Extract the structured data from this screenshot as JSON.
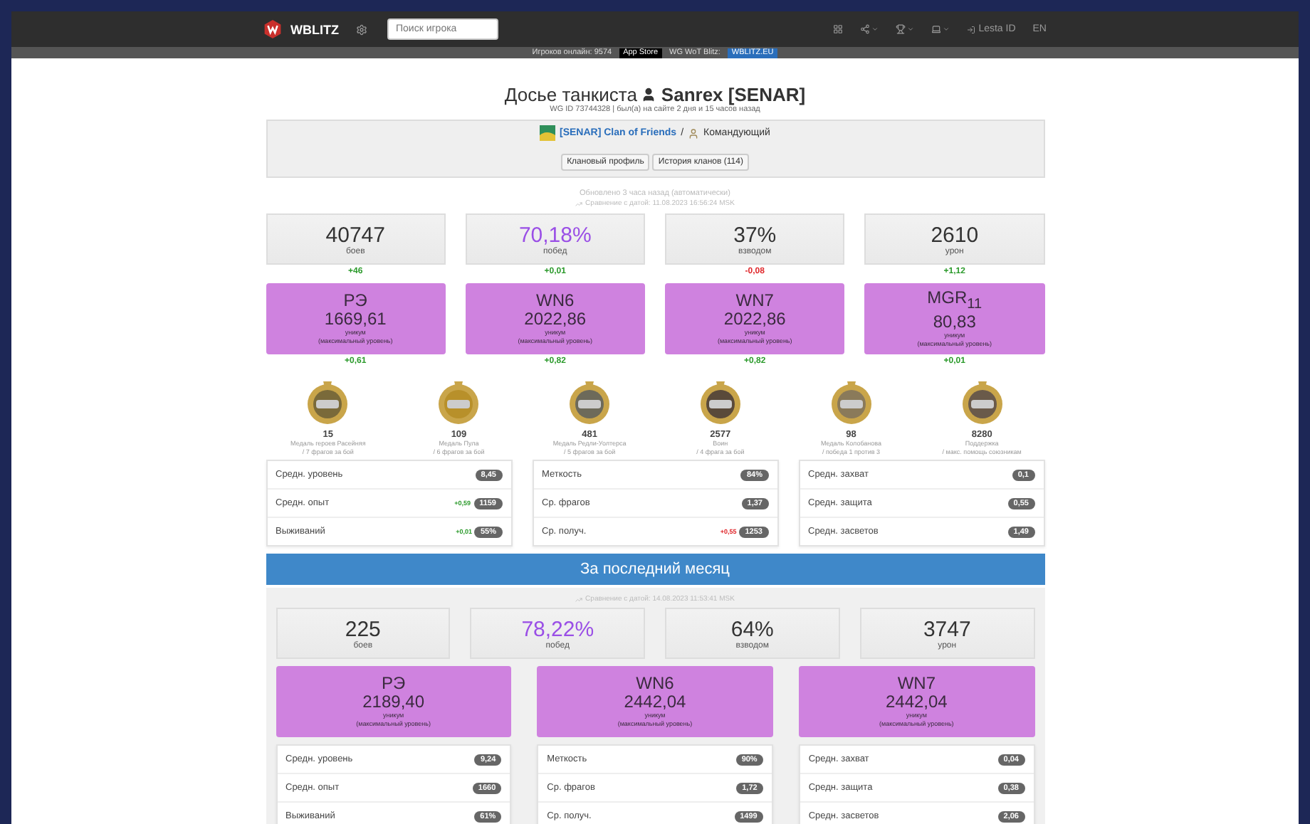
{
  "navbar": {
    "brand": "WBLITZ",
    "search": {
      "placeholder": "Поиск игрока"
    },
    "login": "Lesta ID",
    "language": "EN"
  },
  "subbar": {
    "online": "Игроков онлайн: 9574",
    "store": "App Store",
    "server_label": "WG WoT Blitz:",
    "server_link": "WBLITZ.EU"
  },
  "header": {
    "title": "Досье танкиста",
    "player": "Sanrex [SENAR]",
    "subtitle": "WG ID 73744328 | был(а) на сайте 2 дня и 15 часов назад"
  },
  "clan": {
    "name": "[SENAR] Clan of Friends",
    "separator": "/",
    "role": "Командующий",
    "buttons": [
      "Клановый профиль",
      "История кланов (114)"
    ]
  },
  "updated": "Обновлено 3 часа назад (автоматически)",
  "compare": "Сравнение с датой: 11.08.2023 16:56:24 MSK",
  "stats": [
    {
      "value": "40747",
      "label": "боев",
      "color": "#333333",
      "delta": "+46",
      "negative": false
    },
    {
      "value": "70,18%",
      "label": "побед",
      "color": "#9a4fe6",
      "delta": "+0,01",
      "negative": false
    },
    {
      "value": "37%",
      "label": "взводом",
      "color": "#333333",
      "delta": "-0,08",
      "negative": true
    },
    {
      "value": "2610",
      "label": "урон",
      "color": "#333333",
      "delta": "+1,12",
      "negative": false
    }
  ],
  "ratings": [
    {
      "name": "РЭ",
      "value": "1669,61",
      "level": "уникум",
      "note": "(максимальный уровень)",
      "delta": "+0,61",
      "negative": false
    },
    {
      "name": "WN6",
      "value": "2022,86",
      "level": "уникум",
      "note": "(максимальный уровень)",
      "delta": "+0,82",
      "negative": false
    },
    {
      "name": "WN7",
      "value": "2022,86",
      "level": "уникум",
      "note": "(максимальный уровень)",
      "delta": "+0,82",
      "negative": false
    },
    {
      "name": "MGR$_{11}$",
      "value": "80,83",
      "level": "уникум",
      "note": "(максимальный уровень)",
      "delta": "+0,01",
      "negative": false
    }
  ],
  "medals": [
    {
      "count": "15",
      "name": "Медаль героев Расейняя",
      "description": "/ 7 фрагов за бой"
    },
    {
      "count": "109",
      "name": "Медаль Пула",
      "description": "/ 6 фрагов за бой"
    },
    {
      "count": "481",
      "name": "Медаль Редли-Уолтерса",
      "description": "/ 5 фрагов за бой"
    },
    {
      "count": "2577",
      "name": "Воин",
      "description": "/ 4 фрага за бой"
    },
    {
      "count": "98",
      "name": "Медаль Колобанова",
      "description": "/ победа 1 против 3"
    },
    {
      "count": "8280",
      "name": "Поддержка",
      "description": "/ макс. помощь союзникам"
    }
  ],
  "panels": [
    [
      {
        "label": "Средн. уровень",
        "value": "8,45"
      },
      {
        "label": "Средн. опыт",
        "value": "1159",
        "delta": "+0,59",
        "negative": false
      },
      {
        "label": "Выживаний",
        "value": "55%",
        "delta": "+0,01",
        "negative": false
      }
    ],
    [
      {
        "label": "Меткость",
        "value": "84%"
      },
      {
        "label": "Ср. фрагов",
        "value": "1,37"
      },
      {
        "label": "Ср. получ.",
        "value": "1253",
        "delta": "+0,55",
        "negative": true
      }
    ],
    [
      {
        "label": "Средн. захват",
        "value": "0,1"
      },
      {
        "label": "Средн. защита",
        "value": "0,55"
      },
      {
        "label": "Средн. засветов",
        "value": "1,49"
      }
    ]
  ],
  "month": {
    "title": "За последний месяц",
    "compare": "Сравнение с датой: 14.08.2023 11:53:41 MSK",
    "stats": [
      {
        "value": "225",
        "label": "боев",
        "color": "#333333"
      },
      {
        "value": "78,22%",
        "label": "побед",
        "color": "#9a4fe6"
      },
      {
        "value": "64%",
        "label": "взводом",
        "color": "#333333"
      },
      {
        "value": "3747",
        "label": "урон",
        "color": "#333333"
      }
    ],
    "ratings": [
      {
        "name": "РЭ",
        "value": "2189,40",
        "level": "уникум",
        "note": "(максимальный уровень)"
      },
      {
        "name": "WN6",
        "value": "2442,04",
        "level": "уникум",
        "note": "(максимальный уровень)"
      },
      {
        "name": "WN7",
        "value": "2442,04",
        "level": "уникум",
        "note": "(максимальный уровень)"
      }
    ],
    "panels": [
      [
        {
          "label": "Средн. уровень",
          "value": "9,24"
        },
        {
          "label": "Средн. опыт",
          "value": "1660"
        },
        {
          "label": "Выживаний",
          "value": "61%"
        }
      ],
      [
        {
          "label": "Меткость",
          "value": "90%"
        },
        {
          "label": "Ср. фрагов",
          "value": "1,72"
        },
        {
          "label": "Ср. получ.",
          "value": "1499"
        }
      ],
      [
        {
          "label": "Средн. захват",
          "value": "0,04"
        },
        {
          "label": "Средн. защита",
          "value": "0,38"
        },
        {
          "label": "Средн. засветов",
          "value": "2,06"
        }
      ]
    ]
  }
}
